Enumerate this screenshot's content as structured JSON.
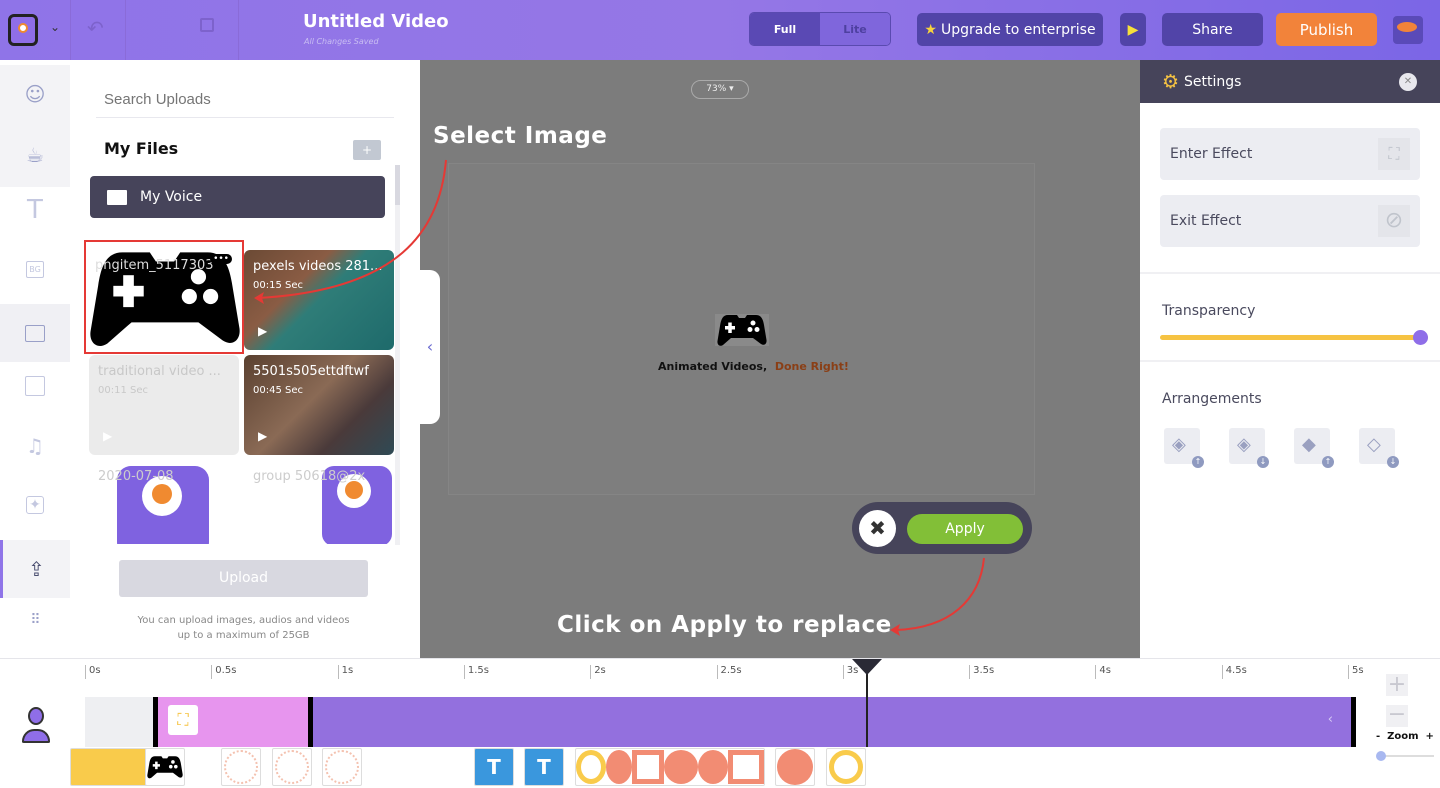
{
  "header": {
    "title": "Untitled Video",
    "subtitle": "All Changes Saved",
    "mode_full": "Full",
    "mode_lite": "Lite",
    "upgrade": "Upgrade to enterprise",
    "share": "Share",
    "publish": "Publish"
  },
  "sidebar": {
    "items": [
      "character",
      "properties",
      "text",
      "background",
      "image",
      "video",
      "music",
      "effects",
      "upload",
      "more"
    ],
    "bg_label": "BG"
  },
  "panel": {
    "search_placeholder": "Search Uploads",
    "my_files": "My Files",
    "folder": "My Voice",
    "files": [
      {
        "name": "pngitem_5117303",
        "duration": ""
      },
      {
        "name": "pexels videos 281...",
        "duration": "00:15 Sec"
      },
      {
        "name": "traditional video ...",
        "duration": "00:11 Sec"
      },
      {
        "name": "5501s505ettdftwf",
        "duration": "00:45 Sec"
      },
      {
        "name": "2020-07-08",
        "duration": ""
      },
      {
        "name": "group 50618@2x",
        "duration": ""
      }
    ],
    "upload": "Upload",
    "note_line1": "You can upload images, audios and videos",
    "note_line2": "up to a maximum of 25GB"
  },
  "canvas": {
    "zoom": "73%",
    "tagline": "Animated Videos,",
    "tagline_accent": "Done Right!",
    "apply": "Apply"
  },
  "annotations": {
    "select": "Select Image",
    "apply": "Click on Apply to replace"
  },
  "settings": {
    "title": "Settings",
    "enter_effect": "Enter Effect",
    "exit_effect": "Exit Effect",
    "transparency": "Transparency",
    "transparency_value": 1.0,
    "arrangements": "Arrangements"
  },
  "timeline": {
    "ticks": [
      "0s",
      "0.5s",
      "1s",
      "1.5s",
      "2s",
      "2.5s",
      "3s",
      "3.5s",
      "4s",
      "4.5s",
      "5s"
    ],
    "playhead": "3.1s",
    "zoom_label": "Zoom",
    "zoom_minus": "-",
    "zoom_plus": "+"
  },
  "colors": {
    "brand": "#8f74e8",
    "publish": "#f2833a",
    "apply": "#82bf37",
    "track": "#9370de",
    "track_selected": "#e795ee",
    "slider": "#f6c342",
    "annotation_arrow": "#e53935"
  }
}
